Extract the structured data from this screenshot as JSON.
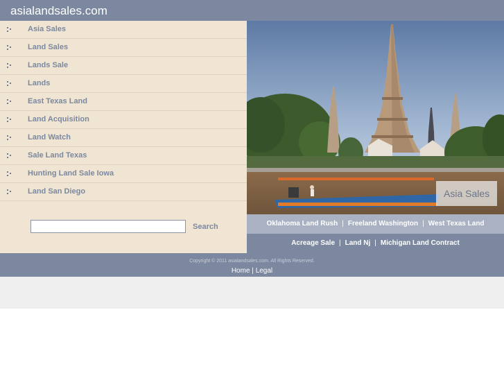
{
  "header": {
    "site_title": "asialandsales.com"
  },
  "sidebar": {
    "items": [
      {
        "label": "Asia Sales"
      },
      {
        "label": "Land Sales"
      },
      {
        "label": "Lands Sale"
      },
      {
        "label": "Lands"
      },
      {
        "label": "East Texas Land"
      },
      {
        "label": "Land Acquisition"
      },
      {
        "label": "Land Watch"
      },
      {
        "label": "Sale Land Texas"
      },
      {
        "label": "Hunting Land Sale Iowa"
      },
      {
        "label": "Land San Diego"
      }
    ]
  },
  "search": {
    "value": "",
    "placeholder": "",
    "button_label": "Search"
  },
  "hero": {
    "caption": "Asia Sales"
  },
  "links": {
    "row1": [
      "Oklahoma Land Rush",
      "Freeland Washington",
      "West Texas Land"
    ],
    "row2": [
      "Acreage Sale",
      "Land Nj",
      "Michigan Land Contract"
    ],
    "separator": "|"
  },
  "footer": {
    "copyright": "Copyright © 2011 asialandsales.com. All Rights Reserved.",
    "home_label": "Home",
    "separator": "|",
    "legal_label": "Legal"
  },
  "colors": {
    "header_bg": "#7b889f",
    "sidebar_bg": "#f0e5d2",
    "link_text": "#7b889f",
    "links_row1_bg": "#a9b1c2",
    "bottom_band": "#efefef"
  }
}
